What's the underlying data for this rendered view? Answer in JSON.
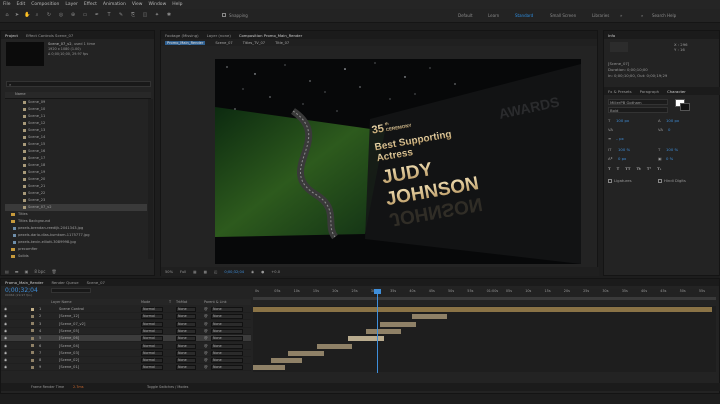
{
  "menu": [
    "File",
    "Edit",
    "Composition",
    "Layer",
    "Effect",
    "Animation",
    "View",
    "Window",
    "Help"
  ],
  "toolbar": {
    "snapping": "Snapping",
    "workspaces": [
      "Default",
      "Learn",
      "Standard",
      "Small Screen",
      "Libraries"
    ],
    "active_workspace": "Standard",
    "search": "Search Help"
  },
  "project": {
    "tab": "Project",
    "effects_tab": "Effect Controls Scene_07",
    "selected_name": "Scene_07_v2",
    "selected_info": ", used 1 time",
    "selected_res": "1920 x 1080 (1.00)",
    "selected_dur": "Δ 0;00;10;00, 29.97 fps",
    "col_name": "Name",
    "items": [
      "Scene_09",
      "Scene_10",
      "Scene_11",
      "Scene_12",
      "Scene_13",
      "Scene_14",
      "Scene_15",
      "Scene_16",
      "Scene_17",
      "Scene_18",
      "Scene_19",
      "Scene_20",
      "Scene_21",
      "Scene_22",
      "Scene_23",
      "Scene_07_v2",
      "Titles",
      "Titles Background",
      "pexels-brendan-reedijk-2041343.jpg",
      "pexels-dario-dias-kumkam-1175777.jpg",
      "pexels-kevin-elliott-3089998.jpg",
      "precomfier",
      "Solids"
    ],
    "bpc": "8 bpc"
  },
  "composition": {
    "tabs": [
      "Footage (Missing)",
      "Layer (none)",
      "Composition Promo_Main_Render"
    ],
    "subtabs": [
      "Promo_Main_Render",
      "Scene_07",
      "Titles_TV_07",
      "Title_07"
    ],
    "zoom": "50%",
    "quality": "Full",
    "timecode": "0;00;32;04",
    "exposure": "+0.0"
  },
  "art": {
    "number": "35",
    "ord": "th",
    "ceremony": "CEREMONY",
    "line1": "Best Supporting",
    "line2": "Actress",
    "name1": "JUDY",
    "name2": "JOHNSON",
    "bg_text": "AWARDS"
  },
  "info": {
    "tab": "Info",
    "x": "X : 296",
    "y": "Y : 16",
    "layer": "[Scene_07]",
    "dur": "Duration: 0;00;10;00",
    "inout": "In: 0;00;10;00, Out: 0;00;19;29",
    "tabs2": [
      "Fx & Presets",
      "Paragraph",
      "Character"
    ],
    "font": "MillerPB Gotham",
    "style": "Bold",
    "size": "100 px",
    "leading": "100 px",
    "tracking": "0",
    "stroke": "– px",
    "vscale": "100 %",
    "hscale": "100 %",
    "baseline": "0 px",
    "tsume": "0 %",
    "ligatures": "Ligatures",
    "hindi": "Hindi Digits"
  },
  "timeline": {
    "tabs": [
      "Promo_Main_Render",
      "Render Queue",
      "Scene_07"
    ],
    "time": "0;00;32;04",
    "frame_info": "00964 (29.97 fps)",
    "cols": [
      "Layer Name",
      "Mode",
      "T",
      "TrkMat",
      "Parent & Link"
    ],
    "layers": [
      {
        "num": "1",
        "name": "Scene Control",
        "mode": "Normal",
        "parent": "None"
      },
      {
        "num": "2",
        "name": "[Scene_12]",
        "mode": "Normal",
        "parent": "None"
      },
      {
        "num": "3",
        "name": "[Scene_07_v2]",
        "mode": "Normal",
        "parent": "None"
      },
      {
        "num": "4",
        "name": "[Scene_05]",
        "mode": "Normal",
        "parent": "None"
      },
      {
        "num": "5",
        "name": "[Scene_06]",
        "mode": "Normal",
        "parent": "None"
      },
      {
        "num": "6",
        "name": "[Scene_04]",
        "mode": "Normal",
        "parent": "None"
      },
      {
        "num": "7",
        "name": "[Scene_03]",
        "mode": "Normal",
        "parent": "None"
      },
      {
        "num": "8",
        "name": "[Scene_02]",
        "mode": "Normal",
        "parent": "None"
      },
      {
        "num": "9",
        "name": "[Scene_01]",
        "mode": "Normal",
        "parent": "None"
      }
    ],
    "trkmat": "None",
    "ruler": [
      "0s",
      "05s",
      "10s",
      "15s",
      "20s",
      "25s",
      "30s",
      "35s",
      "40s",
      "45s",
      "50s",
      "55s",
      "01:00s",
      "05s",
      "10s",
      "15s",
      "20s",
      "25s",
      "30s",
      "35s",
      "40s",
      "45s",
      "50s",
      "55s"
    ],
    "footer_label": "Frame Render Time",
    "footer_value": "2.7ms",
    "toggle": "Toggle Switches / Modes"
  },
  "colors": {
    "accent": "#2e8ee0",
    "bar": "#8f8167",
    "label_orange": "#c79a3c"
  }
}
